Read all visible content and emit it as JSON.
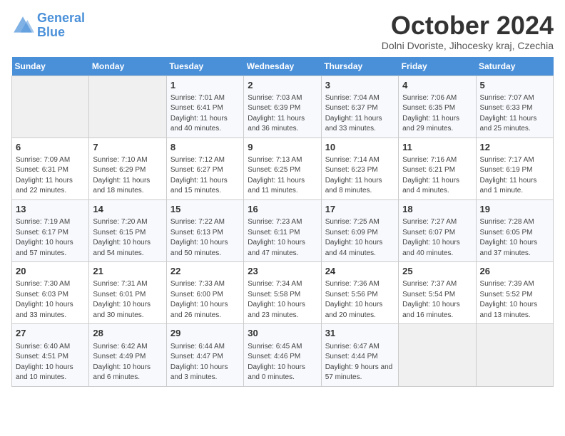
{
  "header": {
    "logo_line1": "General",
    "logo_line2": "Blue",
    "month": "October 2024",
    "location": "Dolni Dvoriste, Jihocesky kraj, Czechia"
  },
  "weekdays": [
    "Sunday",
    "Monday",
    "Tuesday",
    "Wednesday",
    "Thursday",
    "Friday",
    "Saturday"
  ],
  "weeks": [
    [
      {
        "day": "",
        "info": ""
      },
      {
        "day": "",
        "info": ""
      },
      {
        "day": "1",
        "info": "Sunrise: 7:01 AM\nSunset: 6:41 PM\nDaylight: 11 hours and 40 minutes."
      },
      {
        "day": "2",
        "info": "Sunrise: 7:03 AM\nSunset: 6:39 PM\nDaylight: 11 hours and 36 minutes."
      },
      {
        "day": "3",
        "info": "Sunrise: 7:04 AM\nSunset: 6:37 PM\nDaylight: 11 hours and 33 minutes."
      },
      {
        "day": "4",
        "info": "Sunrise: 7:06 AM\nSunset: 6:35 PM\nDaylight: 11 hours and 29 minutes."
      },
      {
        "day": "5",
        "info": "Sunrise: 7:07 AM\nSunset: 6:33 PM\nDaylight: 11 hours and 25 minutes."
      }
    ],
    [
      {
        "day": "6",
        "info": "Sunrise: 7:09 AM\nSunset: 6:31 PM\nDaylight: 11 hours and 22 minutes."
      },
      {
        "day": "7",
        "info": "Sunrise: 7:10 AM\nSunset: 6:29 PM\nDaylight: 11 hours and 18 minutes."
      },
      {
        "day": "8",
        "info": "Sunrise: 7:12 AM\nSunset: 6:27 PM\nDaylight: 11 hours and 15 minutes."
      },
      {
        "day": "9",
        "info": "Sunrise: 7:13 AM\nSunset: 6:25 PM\nDaylight: 11 hours and 11 minutes."
      },
      {
        "day": "10",
        "info": "Sunrise: 7:14 AM\nSunset: 6:23 PM\nDaylight: 11 hours and 8 minutes."
      },
      {
        "day": "11",
        "info": "Sunrise: 7:16 AM\nSunset: 6:21 PM\nDaylight: 11 hours and 4 minutes."
      },
      {
        "day": "12",
        "info": "Sunrise: 7:17 AM\nSunset: 6:19 PM\nDaylight: 11 hours and 1 minute."
      }
    ],
    [
      {
        "day": "13",
        "info": "Sunrise: 7:19 AM\nSunset: 6:17 PM\nDaylight: 10 hours and 57 minutes."
      },
      {
        "day": "14",
        "info": "Sunrise: 7:20 AM\nSunset: 6:15 PM\nDaylight: 10 hours and 54 minutes."
      },
      {
        "day": "15",
        "info": "Sunrise: 7:22 AM\nSunset: 6:13 PM\nDaylight: 10 hours and 50 minutes."
      },
      {
        "day": "16",
        "info": "Sunrise: 7:23 AM\nSunset: 6:11 PM\nDaylight: 10 hours and 47 minutes."
      },
      {
        "day": "17",
        "info": "Sunrise: 7:25 AM\nSunset: 6:09 PM\nDaylight: 10 hours and 44 minutes."
      },
      {
        "day": "18",
        "info": "Sunrise: 7:27 AM\nSunset: 6:07 PM\nDaylight: 10 hours and 40 minutes."
      },
      {
        "day": "19",
        "info": "Sunrise: 7:28 AM\nSunset: 6:05 PM\nDaylight: 10 hours and 37 minutes."
      }
    ],
    [
      {
        "day": "20",
        "info": "Sunrise: 7:30 AM\nSunset: 6:03 PM\nDaylight: 10 hours and 33 minutes."
      },
      {
        "day": "21",
        "info": "Sunrise: 7:31 AM\nSunset: 6:01 PM\nDaylight: 10 hours and 30 minutes."
      },
      {
        "day": "22",
        "info": "Sunrise: 7:33 AM\nSunset: 6:00 PM\nDaylight: 10 hours and 26 minutes."
      },
      {
        "day": "23",
        "info": "Sunrise: 7:34 AM\nSunset: 5:58 PM\nDaylight: 10 hours and 23 minutes."
      },
      {
        "day": "24",
        "info": "Sunrise: 7:36 AM\nSunset: 5:56 PM\nDaylight: 10 hours and 20 minutes."
      },
      {
        "day": "25",
        "info": "Sunrise: 7:37 AM\nSunset: 5:54 PM\nDaylight: 10 hours and 16 minutes."
      },
      {
        "day": "26",
        "info": "Sunrise: 7:39 AM\nSunset: 5:52 PM\nDaylight: 10 hours and 13 minutes."
      }
    ],
    [
      {
        "day": "27",
        "info": "Sunrise: 6:40 AM\nSunset: 4:51 PM\nDaylight: 10 hours and 10 minutes."
      },
      {
        "day": "28",
        "info": "Sunrise: 6:42 AM\nSunset: 4:49 PM\nDaylight: 10 hours and 6 minutes."
      },
      {
        "day": "29",
        "info": "Sunrise: 6:44 AM\nSunset: 4:47 PM\nDaylight: 10 hours and 3 minutes."
      },
      {
        "day": "30",
        "info": "Sunrise: 6:45 AM\nSunset: 4:46 PM\nDaylight: 10 hours and 0 minutes."
      },
      {
        "day": "31",
        "info": "Sunrise: 6:47 AM\nSunset: 4:44 PM\nDaylight: 9 hours and 57 minutes."
      },
      {
        "day": "",
        "info": ""
      },
      {
        "day": "",
        "info": ""
      }
    ]
  ]
}
